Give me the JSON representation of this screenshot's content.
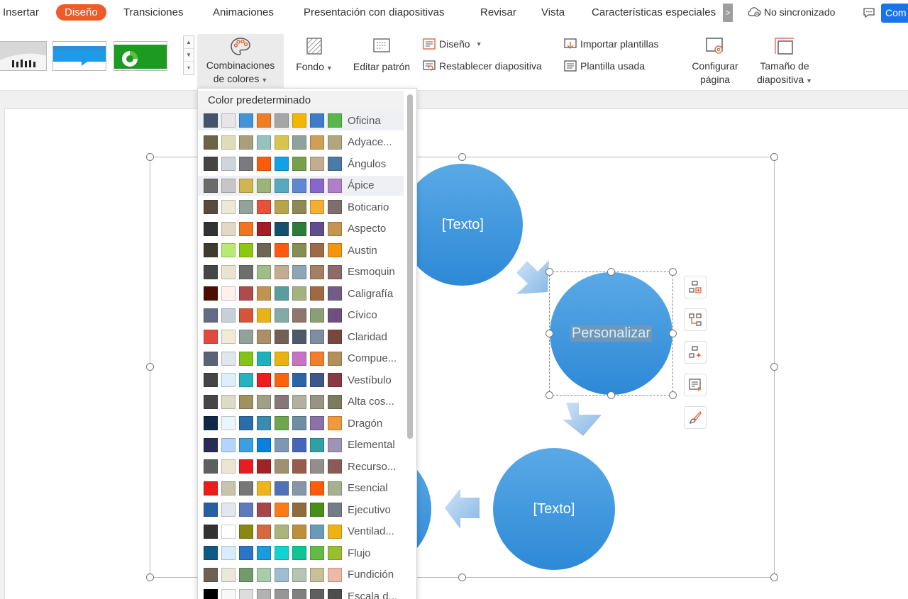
{
  "menu": {
    "items": [
      "Insertar",
      "Diseño",
      "Transiciones",
      "Animaciones",
      "Presentación con diapositivas",
      "Revisar",
      "Vista",
      "Características especiales"
    ],
    "active": "Diseño",
    "more": ">",
    "sync": "No sincronizado",
    "comment_btn": "Com"
  },
  "ribbon": {
    "color_combos": {
      "line1": "Combinaciones",
      "line2": "de colores"
    },
    "fondo": "Fondo",
    "editar_patron": "Editar patrón",
    "diseno": "Diseño",
    "restablecer": "Restablecer diapositiva",
    "importar": "Importar plantillas",
    "plantilla_usada": "Plantilla usada",
    "configurar": {
      "line1": "Configurar",
      "line2": "página"
    },
    "tamano": {
      "line1": "Tamaño de",
      "line2": "diapositiva"
    }
  },
  "slide": {
    "circle_top": "[Texto]",
    "circle_mid": "Personalizar",
    "circle_bottom": "[Texto]"
  },
  "dropdown": {
    "header": "Color predeterminado",
    "schemes": [
      {
        "name": "Oficina",
        "colors": [
          "#44546a",
          "#e7e6e6",
          "#4293d7",
          "#ef7e22",
          "#a5a5a5",
          "#f1b700",
          "#3e7cc9",
          "#56b847"
        ]
      },
      {
        "name": "Adyace...",
        "colors": [
          "#6d6346",
          "#e0dbb8",
          "#a8a07a",
          "#96c2be",
          "#d7c350",
          "#8ea39b",
          "#cf9e57",
          "#b2a681"
        ]
      },
      {
        "name": "Ángulos",
        "colors": [
          "#454545",
          "#cfd5dd",
          "#797b7e",
          "#fc5a0c",
          "#11a1e4",
          "#78a04b",
          "#c3ad90",
          "#4a7aa8"
        ]
      },
      {
        "name": "Ápice",
        "colors": [
          "#6b6b6b",
          "#c6c6c6",
          "#cfb651",
          "#9bb578",
          "#54aabf",
          "#5f87d2",
          "#8a66cb",
          "#b17fc7"
        ]
      },
      {
        "name": "Boticario",
        "colors": [
          "#564b3c",
          "#ece9d7",
          "#94a39a",
          "#e7523a",
          "#b8a54a",
          "#8e8a54",
          "#f5ae35",
          "#806e6d"
        ]
      },
      {
        "name": "Aspecto",
        "colors": [
          "#323232",
          "#e2d8c4",
          "#f0751e",
          "#a11e25",
          "#12506f",
          "#2c7d39",
          "#624c8e",
          "#c59650"
        ]
      },
      {
        "name": "Austin",
        "colors": [
          "#3e3d2d",
          "#b8ea72",
          "#8ac90f",
          "#6f6554",
          "#fc5a11",
          "#888d51",
          "#9e6947",
          "#f4950d"
        ]
      },
      {
        "name": "Esmoquin",
        "colors": [
          "#464646",
          "#e9e3d0",
          "#6d6e6e",
          "#a1bd87",
          "#c3ad92",
          "#8da5b9",
          "#a38063",
          "#8e6a6a"
        ]
      },
      {
        "name": "Caligrafía",
        "colors": [
          "#4a0f02",
          "#fff0eb",
          "#ae4b4b",
          "#c09350",
          "#5b9c9c",
          "#a4b282",
          "#9d6a43",
          "#715c86"
        ]
      },
      {
        "name": "Cívico",
        "colors": [
          "#646b86",
          "#c5d1d7",
          "#d3563a",
          "#e7b418",
          "#84aaa7",
          "#8f776d",
          "#8a9f76",
          "#704f80"
        ]
      },
      {
        "name": "Claridad",
        "colors": [
          "#e4493f",
          "#f1ead7",
          "#93a299",
          "#ad8f67",
          "#726056",
          "#4c5a6a",
          "#808da0",
          "#79463d"
        ]
      },
      {
        "name": "Compue...",
        "colors": [
          "#5a6379",
          "#e1e5ec",
          "#83c41a",
          "#21b0bb",
          "#e8b312",
          "#c673c6",
          "#f07e2c",
          "#b3905b"
        ]
      },
      {
        "name": "Vestíbulo",
        "colors": [
          "#454545",
          "#ddeefc",
          "#28b1bf",
          "#f31c1c",
          "#fd630d",
          "#2c64a6",
          "#40578c",
          "#8a3a41"
        ]
      },
      {
        "name": "Alta cos...",
        "colors": [
          "#464646",
          "#dedbc5",
          "#9f925f",
          "#a09e86",
          "#86777a",
          "#b3b0a0",
          "#979483",
          "#7b7b5f"
        ]
      },
      {
        "name": "Dragón",
        "colors": [
          "#0f2a47",
          "#ebf5ff",
          "#2b6da9",
          "#3b8bae",
          "#6ea64d",
          "#6d8ea3",
          "#8c70a8",
          "#f0993d"
        ]
      },
      {
        "name": "Elemental",
        "colors": [
          "#2b2b57",
          "#b3d4ff",
          "#3d9ee0",
          "#0b7fe0",
          "#7e98b4",
          "#4567b8",
          "#2fa1a5",
          "#9f93b9"
        ]
      },
      {
        "name": "Recurso...",
        "colors": [
          "#5f5f5f",
          "#ebe5d1",
          "#e51f1f",
          "#a12225",
          "#a08f70",
          "#9a5a4c",
          "#938e8a",
          "#8d5a5a"
        ]
      },
      {
        "name": "Esencial",
        "colors": [
          "#ea1d1d",
          "#c8c4ac",
          "#777777",
          "#eeb41b",
          "#4e72b8",
          "#8596a8",
          "#fd5c0b",
          "#a5b28d"
        ]
      },
      {
        "name": "Ejecutivo",
        "colors": [
          "#275fa3",
          "#e2e6ed",
          "#5d7bbd",
          "#a8464b",
          "#fd7b16",
          "#8f6c3e",
          "#4a8d19",
          "#737c87"
        ]
      },
      {
        "name": "Ventilad...",
        "colors": [
          "#323232",
          "#ffffff",
          "#8a8712",
          "#d4683f",
          "#a9b57c",
          "#bb8f3d",
          "#6a9ab5",
          "#eeb214"
        ]
      },
      {
        "name": "Flujo",
        "colors": [
          "#0e5a87",
          "#d6eefc",
          "#2a75c9",
          "#1a9ae0",
          "#12d2d2",
          "#12c493",
          "#64bb43",
          "#9abf2e"
        ]
      },
      {
        "name": "Fundición",
        "colors": [
          "#6d6155",
          "#ebe7da",
          "#729a6a",
          "#a8ccac",
          "#9cbecf",
          "#b6c4b4",
          "#c9c09a",
          "#efb8a8"
        ]
      },
      {
        "name": "Escala d...",
        "colors": [
          "#000000",
          "#f8f8f8",
          "#dddddd",
          "#b2b2b2",
          "#969696",
          "#808080",
          "#5f5f5f",
          "#4d4d4d"
        ]
      }
    ]
  }
}
